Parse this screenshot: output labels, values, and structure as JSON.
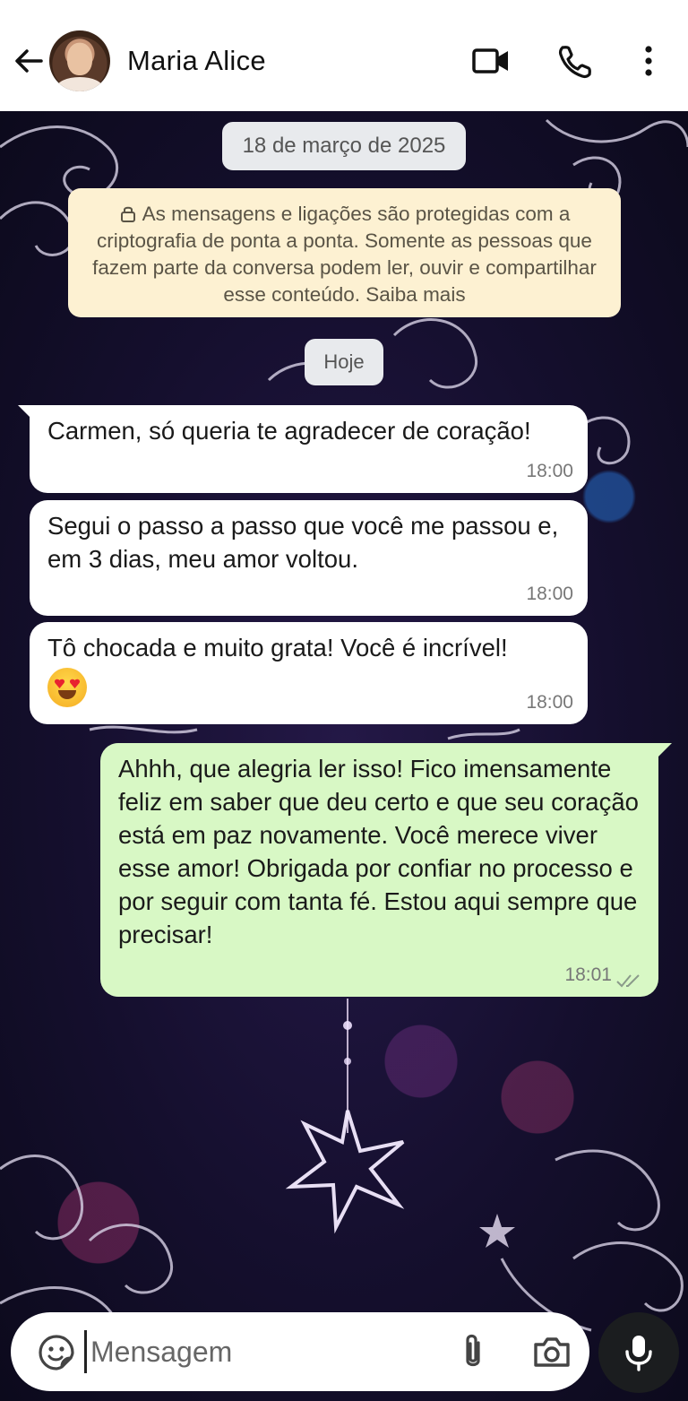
{
  "header": {
    "contact_name": "Maria Alice",
    "back_icon": "arrow-left-icon",
    "actions": [
      "video-call-icon",
      "voice-call-icon",
      "more-vert-icon"
    ]
  },
  "chat": {
    "date_label": "18 de março de 2025",
    "encryption_notice": "As mensagens e ligações são protegidas com a criptografia de ponta a ponta. Somente as pessoas que fazem parte da conversa podem ler, ouvir e compartilhar esse conteúdo. Saiba mais",
    "today_label": "Hoje",
    "messages": [
      {
        "direction": "incoming",
        "text": "Carmen, só queria te agradecer de coração!",
        "time": "18:00"
      },
      {
        "direction": "incoming",
        "text": "Segui o passo a passo que você me passou e, em 3 dias, meu amor voltou.",
        "time": "18:00"
      },
      {
        "direction": "incoming",
        "text": "Tô chocada e muito grata! Você é incrível!",
        "emoji": "heart-eyes-emoji",
        "time": "18:00"
      },
      {
        "direction": "outgoing",
        "text": "Ahhh, que alegria ler isso! Fico imensamente feliz em saber que deu certo e que seu coração está em paz novamente. Você merece viver esse amor! Obrigada por confiar no processo e por seguir com tanta fé. Estou aqui sempre que precisar!",
        "time": "18:01",
        "status": "read-double-check-icon"
      }
    ]
  },
  "composer": {
    "placeholder": "Mensagem",
    "value": ""
  },
  "colors": {
    "incoming_bubble": "#ffffff",
    "outgoing_bubble": "#d8f8c5",
    "notice_bg": "#fdf1d2",
    "mic_button": "#1b1d1f"
  }
}
